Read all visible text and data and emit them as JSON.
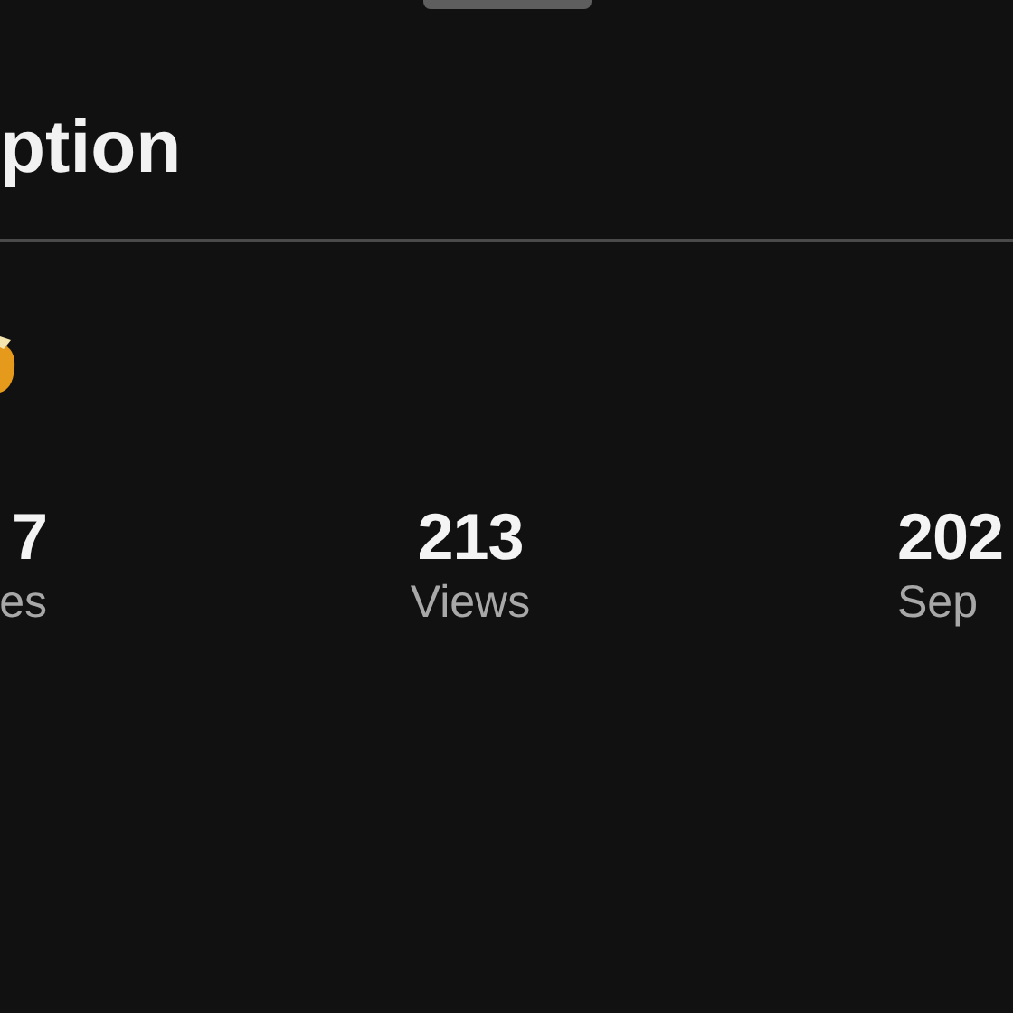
{
  "header": {
    "title": "ption"
  },
  "stats": [
    {
      "value": "7",
      "label": "es"
    },
    {
      "value": "213",
      "label": "Views"
    },
    {
      "value": "202",
      "label": "Sep"
    }
  ]
}
